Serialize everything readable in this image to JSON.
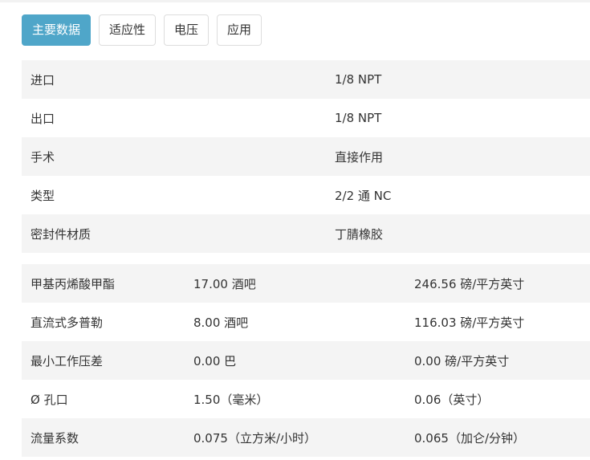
{
  "tabs": [
    {
      "label": "主要数据",
      "active": true
    },
    {
      "label": "适应性",
      "active": false
    },
    {
      "label": "电压",
      "active": false
    },
    {
      "label": "应用",
      "active": false
    }
  ],
  "general_specs": [
    {
      "name": "进口",
      "value": "1/8 NPT"
    },
    {
      "name": "出口",
      "value": "1/8 NPT"
    },
    {
      "name": "手术",
      "value": "直接作用"
    },
    {
      "name": "类型",
      "value": "2/2 通 NC"
    },
    {
      "name": "密封件材质",
      "value": "丁腈橡胶"
    }
  ],
  "pressure_specs": [
    {
      "name": "甲基丙烯酸甲酯",
      "metric": "17.00 酒吧",
      "imperial": "246.56 磅/平方英寸"
    },
    {
      "name": "直流式多普勒",
      "metric": "8.00 酒吧",
      "imperial": "116.03 磅/平方英寸"
    },
    {
      "name": "最小工作压差",
      "metric": "0.00 巴",
      "imperial": "0.00 磅/平方英寸"
    },
    {
      "name": "Ø 孔口",
      "metric": "1.50（毫米）",
      "imperial": "0.06（英寸）"
    },
    {
      "name": "流量系数",
      "metric": "0.075（立方米/小时）",
      "imperial": "0.065（加仑/分钟）"
    }
  ]
}
